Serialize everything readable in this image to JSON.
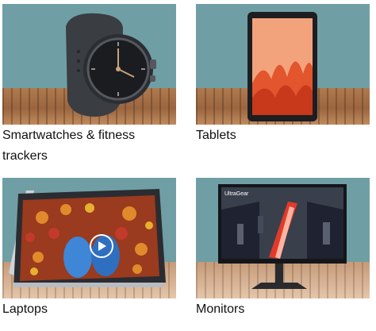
{
  "categories": [
    {
      "label": "Smartwatches & fitness trackers",
      "icon": "smartwatch-image"
    },
    {
      "label": "Tablets",
      "icon": "tablet-image"
    },
    {
      "label": "Laptops",
      "icon": "laptop-image"
    },
    {
      "label": "Monitors",
      "icon": "monitor-image"
    }
  ],
  "monitor_brand_text": "UltraGear",
  "colors": {
    "wall": "#6f9fa4",
    "wood": "#a8734a",
    "text": "#0f1111"
  }
}
